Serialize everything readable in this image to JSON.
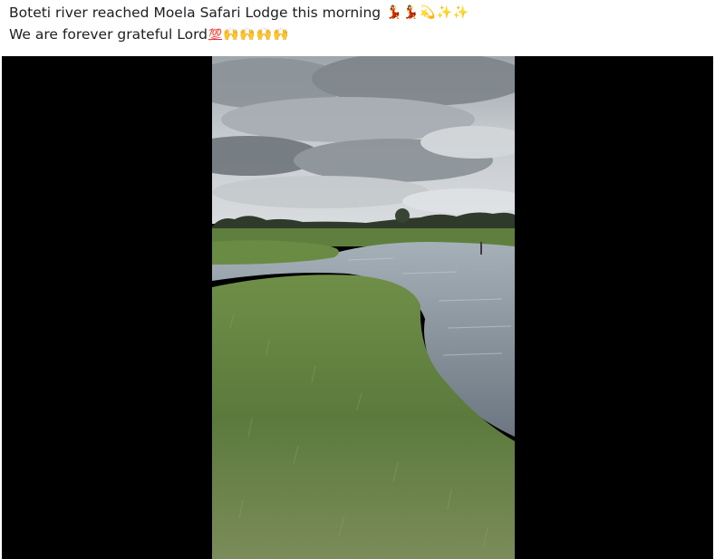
{
  "post": {
    "line1": {
      "text": "Boteti river reached Moela Safari Lodge this morning",
      "emojis": [
        {
          "name": "dancer-emoji",
          "glyph": "💃",
          "color": "#c2272d"
        },
        {
          "name": "dancer-emoji",
          "glyph": "💃",
          "color": "#c2272d"
        },
        {
          "name": "dizzy-emoji",
          "glyph": "💫",
          "color": "#e9b000"
        },
        {
          "name": "sparkles-emoji",
          "glyph": "✨",
          "color": "#f2c200"
        },
        {
          "name": "sparkles-emoji",
          "glyph": "✨",
          "color": "#f2c200"
        }
      ]
    },
    "line2": {
      "text": "We are forever grateful Lord",
      "emojis": [
        {
          "name": "hundred-points-emoji",
          "glyph": "💯",
          "color": "#e0245e"
        },
        {
          "name": "raising-hands-emoji",
          "glyph": "🙌",
          "color": "#f0b400"
        },
        {
          "name": "raising-hands-emoji",
          "glyph": "🙌",
          "color": "#f0b400"
        },
        {
          "name": "raising-hands-emoji",
          "glyph": "🙌",
          "color": "#f0b400"
        },
        {
          "name": "raising-hands-emoji",
          "glyph": "🙌",
          "color": "#f0b400"
        }
      ]
    }
  },
  "video": {
    "scene": "flooded grassland under cloudy sky",
    "colors": {
      "letterbox": "#000000",
      "sky": "#b9bfc4",
      "cloud_dark": "#5f666b",
      "grass": "#5e7d3f",
      "water": "#8a96a0"
    }
  }
}
